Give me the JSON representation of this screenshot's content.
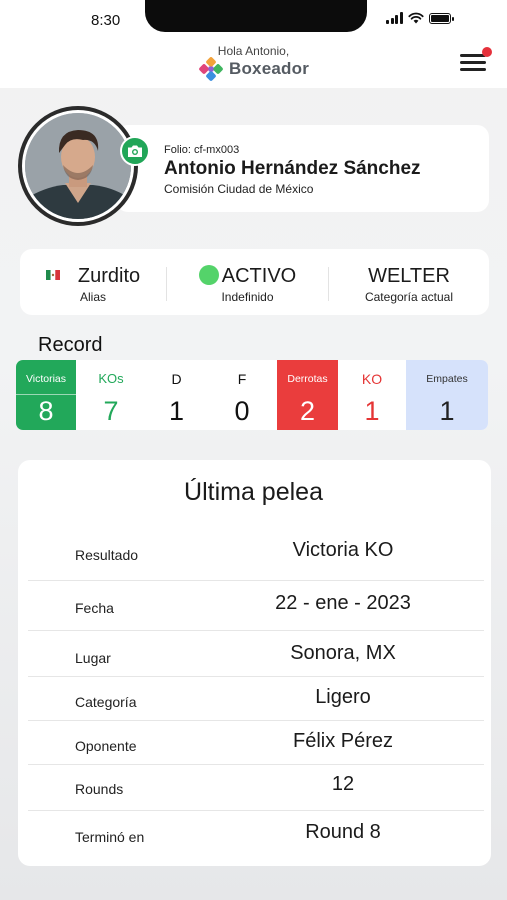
{
  "status_bar": {
    "time": "8:30"
  },
  "header": {
    "greeting": "Hola Antonio,",
    "brand": "Boxeador",
    "colors": {
      "notification_dot": "#e5313b"
    }
  },
  "profile": {
    "folio": "Folio: cf-mx003",
    "name": "Antonio Hernández Sánchez",
    "commission": "Comisión Ciudad de México",
    "icons": {
      "camera": "camera-icon"
    }
  },
  "info": {
    "alias": {
      "value": "Zurdito",
      "label": "Alias"
    },
    "status": {
      "value": "ACTIVO",
      "label": "Indefinido",
      "color": "#54d36a"
    },
    "category": {
      "value": "WELTER",
      "label": "Categoría actual"
    }
  },
  "record": {
    "title": "Record",
    "columns": [
      {
        "label": "Victorias",
        "value": "8",
        "bg": "#22a85a",
        "label_color": "#ffffff",
        "value_color": "#ffffff"
      },
      {
        "label": "KOs",
        "value": "7",
        "bg": "#ffffff",
        "label_color": "#22a85a",
        "value_color": "#22a85a"
      },
      {
        "label": "D",
        "value": "1",
        "bg": "#ffffff",
        "label_color": "#111111",
        "value_color": "#111111"
      },
      {
        "label": "F",
        "value": "0",
        "bg": "#ffffff",
        "label_color": "#111111",
        "value_color": "#111111"
      },
      {
        "label": "Derrotas",
        "value": "2",
        "bg": "#ea3d3d",
        "label_color": "#ffffff",
        "value_color": "#ffffff"
      },
      {
        "label": "KO",
        "value": "1",
        "bg": "#ffffff",
        "label_color": "#e53535",
        "value_color": "#e53535"
      },
      {
        "label": "Empates",
        "value": "1",
        "bg": "#d6e2fb",
        "label_color": "#333333",
        "value_color": "#222222"
      }
    ]
  },
  "last_fight": {
    "title": "Última pelea",
    "rows": [
      {
        "key": "Resultado",
        "value": "Victoria KO"
      },
      {
        "key": "Fecha",
        "value": "22 - ene - 2023"
      },
      {
        "key": "Lugar",
        "value": "Sonora, MX"
      },
      {
        "key": "Categoría",
        "value": "Ligero"
      },
      {
        "key": "Oponente",
        "value": "Félix Pérez"
      },
      {
        "key": "Rounds",
        "value": "12"
      },
      {
        "key": "Terminó en",
        "value": "Round 8"
      }
    ]
  }
}
